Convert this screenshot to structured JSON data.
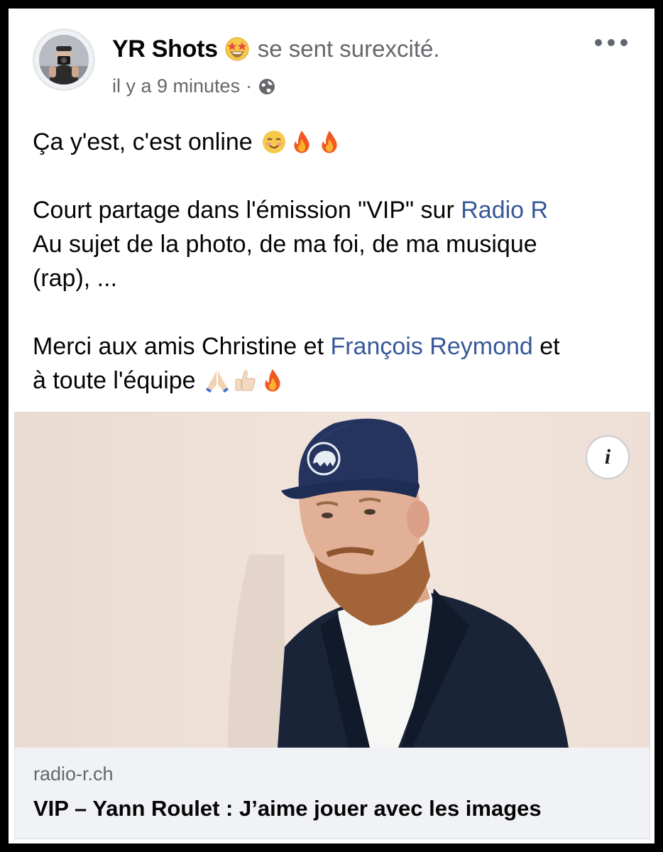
{
  "post": {
    "author": "YR Shots",
    "feeling_icon": "star-struck-emoji",
    "feeling_text": "se sent surexcité.",
    "timestamp": "il y a 9 minutes",
    "dot": "·",
    "privacy_icon": "globe-icon",
    "text": {
      "line1": "Ça y'est, c'est online",
      "line1_emojis": [
        "smiling-blushing-emoji",
        "fire-emoji",
        "fire-emoji"
      ],
      "line2_prefix": "Court partage dans l'émission \"VIP\" sur ",
      "line2_link": "Radio R",
      "line3": "Au sujet de la photo, de ma foi, de ma musique",
      "line4": "(rap), ...",
      "line5_prefix": "Merci aux amis Christine et ",
      "line5_link": "François Reymond",
      "line5_suffix": " et",
      "line6": "à toute l'équipe",
      "line6_emojis": [
        "folded-hands-emoji",
        "thumbs-up-emoji",
        "fire-emoji"
      ]
    }
  },
  "preview": {
    "domain": "radio-r.ch",
    "title": "VIP – Yann Roulet : J’aime jouer avec les images",
    "info_label": "i"
  },
  "colors": {
    "link": "#385898",
    "secondary_text": "#65676b",
    "cap": "#1f2f55",
    "jacket": "#1a2438"
  }
}
